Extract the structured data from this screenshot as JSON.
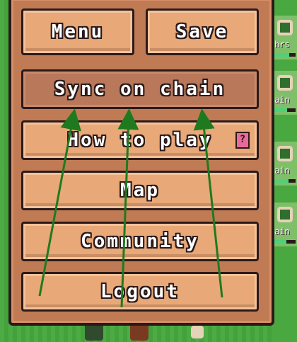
{
  "menu": {
    "buttons": [
      {
        "id": "menu",
        "label": "Menu"
      },
      {
        "id": "save",
        "label": "Save"
      },
      {
        "id": "sync",
        "label": "Sync on chain"
      },
      {
        "id": "how",
        "label": "How to play"
      },
      {
        "id": "map",
        "label": "Map"
      },
      {
        "id": "community",
        "label": "Community"
      },
      {
        "id": "logout",
        "label": "Logout"
      }
    ],
    "help_icon": "?"
  },
  "side_cards": [
    {
      "text": "hrs",
      "bar": 0.7
    },
    {
      "text": "ain",
      "bar": 0.6
    },
    {
      "text": "ain",
      "bar": 0.65
    },
    {
      "text": "ain",
      "bar": 0.55
    }
  ],
  "colors": {
    "arrow": "#1f7a1f",
    "button": "#e8a877",
    "panel": "#c07b55"
  },
  "icons": {
    "help": "question-mark-icon"
  }
}
